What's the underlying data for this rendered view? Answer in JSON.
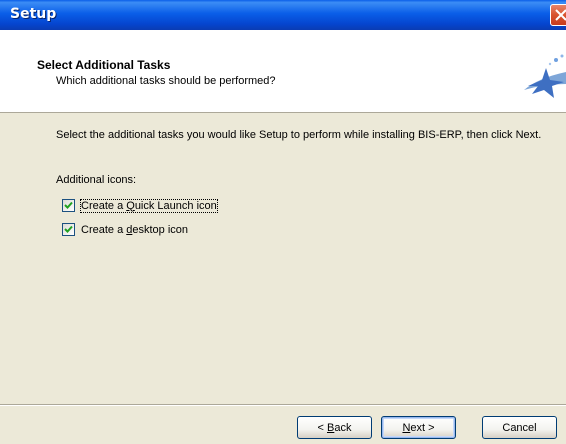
{
  "window": {
    "title": "Setup"
  },
  "header": {
    "title": "Select Additional Tasks",
    "subtitle": "Which additional tasks should be performed?",
    "logo_icon": "setup-wizard-icon"
  },
  "main": {
    "intro_text": "Select the additional tasks you would like Setup to perform while installing BIS-ERP, then click Next.",
    "group_label": "Additional icons:",
    "tasks": [
      {
        "label_pre": "Create a ",
        "accel": "Q",
        "label_post": "uick Launch icon",
        "checked": true,
        "focused": true
      },
      {
        "label_pre": "Create a ",
        "accel": "d",
        "label_post": "esktop icon",
        "checked": true,
        "focused": false
      }
    ]
  },
  "buttons": {
    "back_accel": "B",
    "back_post": "ack",
    "back_prefix": "< ",
    "next_accel": "N",
    "next_post": "ext >",
    "cancel": "Cancel"
  },
  "colors": {
    "titlebar": "#0A5EE8",
    "window_bg": "#ECE9D8",
    "header_bg": "#FFFFFF",
    "checkmark": "#21A121"
  }
}
